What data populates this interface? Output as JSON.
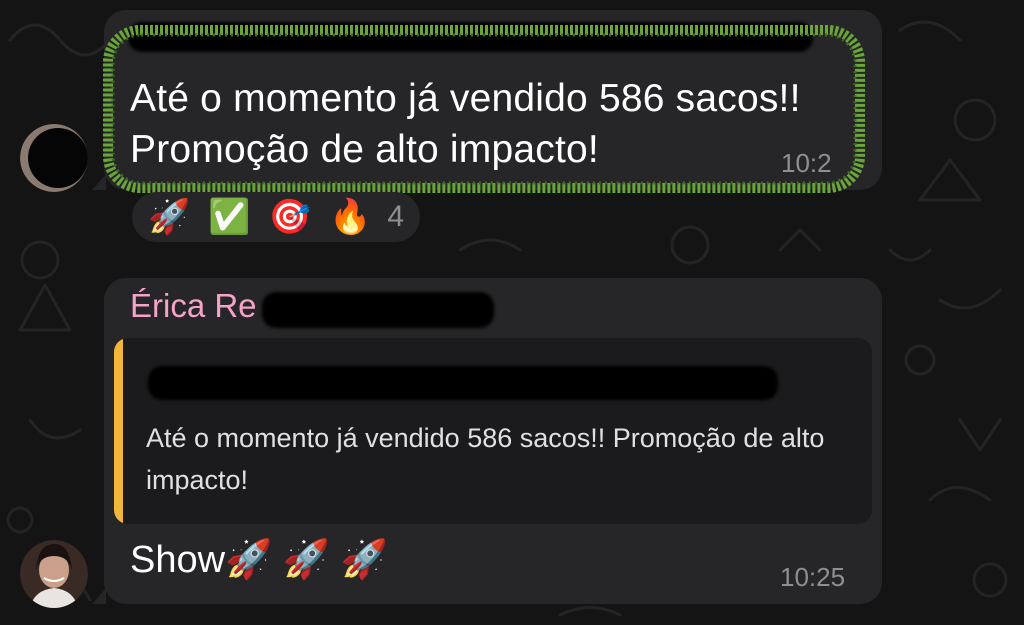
{
  "colors": {
    "background": "#141414",
    "bubble": "#262628",
    "highlight": "#6aa53a",
    "sender_name": "#f5a3c7",
    "quote_bar": "#f2b63c",
    "timestamp": "#8e8e93"
  },
  "messages": [
    {
      "text_line1": "Até o momento já vendido 586 sacos!!",
      "text_line2": "Promoção de alto impacto!",
      "time": "10:2",
      "highlighted": true,
      "reactions": [
        {
          "emoji": "🚀",
          "icon": "rocket-icon"
        },
        {
          "emoji": "✅",
          "icon": "check-mark-icon"
        },
        {
          "emoji": "🎯",
          "icon": "target-icon"
        },
        {
          "emoji": "🔥",
          "icon": "fire-icon"
        }
      ],
      "reaction_count": "4"
    },
    {
      "sender": "Érica Re",
      "quote_text": "Até o momento já vendido 586 sacos!! Promoção de alto impacto!",
      "text": "Show🚀 🚀 🚀",
      "time": "10:25"
    }
  ]
}
